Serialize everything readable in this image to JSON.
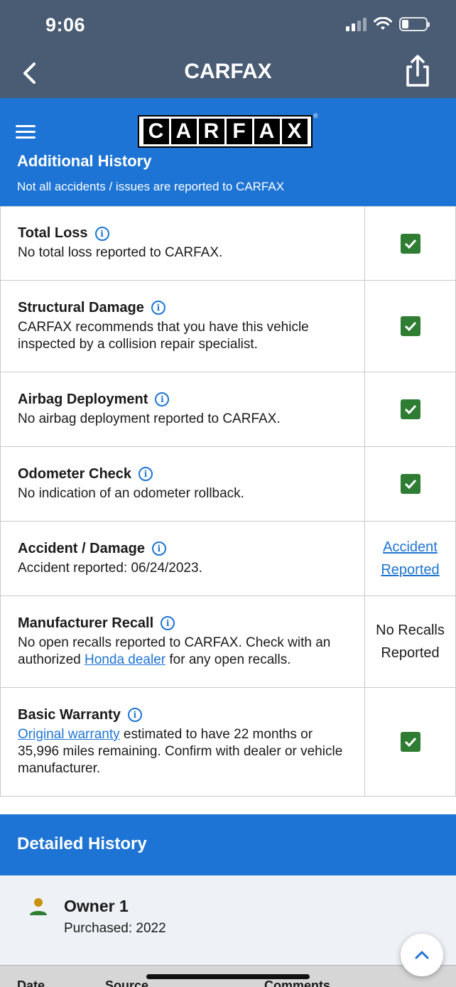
{
  "status_bar": {
    "time": "9:06"
  },
  "header": {
    "title": "CARFAX"
  },
  "brand": {
    "logo_letters": [
      "C",
      "A",
      "R",
      "F",
      "A",
      "X"
    ],
    "registered_mark": "®",
    "section_title": "Additional History",
    "disclaimer": "Not all accidents / issues are reported to CARFAX"
  },
  "history_rows": [
    {
      "title": "Total Loss",
      "desc": "No total loss reported to CARFAX.",
      "status": "check"
    },
    {
      "title": "Structural Damage",
      "desc": "CARFAX recommends that you have this vehicle inspected by a collision repair specialist.",
      "status": "check"
    },
    {
      "title": "Airbag Deployment",
      "desc": "No airbag deployment reported to CARFAX.",
      "status": "check"
    },
    {
      "title": "Odometer Check",
      "desc": "No indication of an odometer rollback.",
      "status": "check"
    },
    {
      "title": "Accident / Damage",
      "desc": "Accident reported: 06/24/2023.",
      "status_link_line1": "Accident",
      "status_link_line2": "Reported"
    },
    {
      "title": "Manufacturer Recall",
      "desc_before": "No open recalls reported to CARFAX. Check with an authorized ",
      "desc_link": "Honda dealer",
      "desc_after": " for any open recalls.",
      "status_text_line1": "No Recalls",
      "status_text_line2": "Reported"
    },
    {
      "title": "Basic Warranty",
      "desc_link": "Original warranty",
      "desc_after": " estimated to have 22 months or 35,996 miles remaining. Confirm with dealer or vehicle manufacturer.",
      "status": "check"
    }
  ],
  "detailed_history": {
    "title": "Detailed History",
    "owner_title": "Owner 1",
    "owner_purchased": "Purchased: 2022",
    "columns": [
      "Date",
      "Source",
      "Comments"
    ]
  },
  "colors": {
    "header_gray": "#4a5b74",
    "brand_blue": "#1d74d4",
    "check_green": "#2e7d32"
  },
  "icons": [
    "back-chevron-icon",
    "share-icon",
    "hamburger-icon",
    "info-icon",
    "checkmark-icon",
    "person-icon",
    "chevron-up-icon"
  ]
}
